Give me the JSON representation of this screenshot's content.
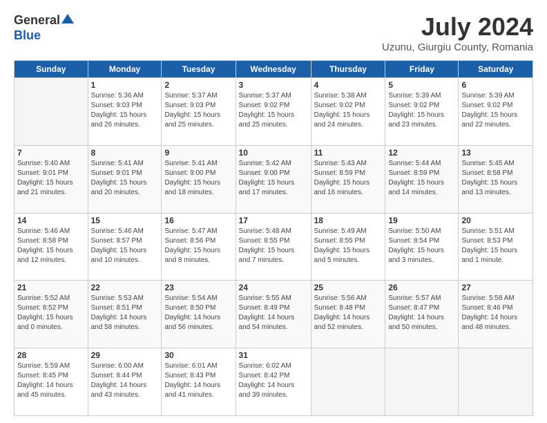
{
  "logo": {
    "general": "General",
    "blue": "Blue"
  },
  "title": "July 2024",
  "subtitle": "Uzunu, Giurgiu County, Romania",
  "days_of_week": [
    "Sunday",
    "Monday",
    "Tuesday",
    "Wednesday",
    "Thursday",
    "Friday",
    "Saturday"
  ],
  "weeks": [
    [
      {
        "day": "",
        "info": ""
      },
      {
        "day": "1",
        "info": "Sunrise: 5:36 AM\nSunset: 9:03 PM\nDaylight: 15 hours\nand 26 minutes."
      },
      {
        "day": "2",
        "info": "Sunrise: 5:37 AM\nSunset: 9:03 PM\nDaylight: 15 hours\nand 25 minutes."
      },
      {
        "day": "3",
        "info": "Sunrise: 5:37 AM\nSunset: 9:02 PM\nDaylight: 15 hours\nand 25 minutes."
      },
      {
        "day": "4",
        "info": "Sunrise: 5:38 AM\nSunset: 9:02 PM\nDaylight: 15 hours\nand 24 minutes."
      },
      {
        "day": "5",
        "info": "Sunrise: 5:39 AM\nSunset: 9:02 PM\nDaylight: 15 hours\nand 23 minutes."
      },
      {
        "day": "6",
        "info": "Sunrise: 5:39 AM\nSunset: 9:02 PM\nDaylight: 15 hours\nand 22 minutes."
      }
    ],
    [
      {
        "day": "7",
        "info": "Sunrise: 5:40 AM\nSunset: 9:01 PM\nDaylight: 15 hours\nand 21 minutes."
      },
      {
        "day": "8",
        "info": "Sunrise: 5:41 AM\nSunset: 9:01 PM\nDaylight: 15 hours\nand 20 minutes."
      },
      {
        "day": "9",
        "info": "Sunrise: 5:41 AM\nSunset: 9:00 PM\nDaylight: 15 hours\nand 18 minutes."
      },
      {
        "day": "10",
        "info": "Sunrise: 5:42 AM\nSunset: 9:00 PM\nDaylight: 15 hours\nand 17 minutes."
      },
      {
        "day": "11",
        "info": "Sunrise: 5:43 AM\nSunset: 8:59 PM\nDaylight: 15 hours\nand 16 minutes."
      },
      {
        "day": "12",
        "info": "Sunrise: 5:44 AM\nSunset: 8:59 PM\nDaylight: 15 hours\nand 14 minutes."
      },
      {
        "day": "13",
        "info": "Sunrise: 5:45 AM\nSunset: 8:58 PM\nDaylight: 15 hours\nand 13 minutes."
      }
    ],
    [
      {
        "day": "14",
        "info": "Sunrise: 5:46 AM\nSunset: 8:58 PM\nDaylight: 15 hours\nand 12 minutes."
      },
      {
        "day": "15",
        "info": "Sunrise: 5:46 AM\nSunset: 8:57 PM\nDaylight: 15 hours\nand 10 minutes."
      },
      {
        "day": "16",
        "info": "Sunrise: 5:47 AM\nSunset: 8:56 PM\nDaylight: 15 hours\nand 8 minutes."
      },
      {
        "day": "17",
        "info": "Sunrise: 5:48 AM\nSunset: 8:55 PM\nDaylight: 15 hours\nand 7 minutes."
      },
      {
        "day": "18",
        "info": "Sunrise: 5:49 AM\nSunset: 8:55 PM\nDaylight: 15 hours\nand 5 minutes."
      },
      {
        "day": "19",
        "info": "Sunrise: 5:50 AM\nSunset: 8:54 PM\nDaylight: 15 hours\nand 3 minutes."
      },
      {
        "day": "20",
        "info": "Sunrise: 5:51 AM\nSunset: 8:53 PM\nDaylight: 15 hours\nand 1 minute."
      }
    ],
    [
      {
        "day": "21",
        "info": "Sunrise: 5:52 AM\nSunset: 8:52 PM\nDaylight: 15 hours\nand 0 minutes."
      },
      {
        "day": "22",
        "info": "Sunrise: 5:53 AM\nSunset: 8:51 PM\nDaylight: 14 hours\nand 58 minutes."
      },
      {
        "day": "23",
        "info": "Sunrise: 5:54 AM\nSunset: 8:50 PM\nDaylight: 14 hours\nand 56 minutes."
      },
      {
        "day": "24",
        "info": "Sunrise: 5:55 AM\nSunset: 8:49 PM\nDaylight: 14 hours\nand 54 minutes."
      },
      {
        "day": "25",
        "info": "Sunrise: 5:56 AM\nSunset: 8:48 PM\nDaylight: 14 hours\nand 52 minutes."
      },
      {
        "day": "26",
        "info": "Sunrise: 5:57 AM\nSunset: 8:47 PM\nDaylight: 14 hours\nand 50 minutes."
      },
      {
        "day": "27",
        "info": "Sunrise: 5:58 AM\nSunset: 8:46 PM\nDaylight: 14 hours\nand 48 minutes."
      }
    ],
    [
      {
        "day": "28",
        "info": "Sunrise: 5:59 AM\nSunset: 8:45 PM\nDaylight: 14 hours\nand 45 minutes."
      },
      {
        "day": "29",
        "info": "Sunrise: 6:00 AM\nSunset: 8:44 PM\nDaylight: 14 hours\nand 43 minutes."
      },
      {
        "day": "30",
        "info": "Sunrise: 6:01 AM\nSunset: 8:43 PM\nDaylight: 14 hours\nand 41 minutes."
      },
      {
        "day": "31",
        "info": "Sunrise: 6:02 AM\nSunset: 8:42 PM\nDaylight: 14 hours\nand 39 minutes."
      },
      {
        "day": "",
        "info": ""
      },
      {
        "day": "",
        "info": ""
      },
      {
        "day": "",
        "info": ""
      }
    ]
  ]
}
